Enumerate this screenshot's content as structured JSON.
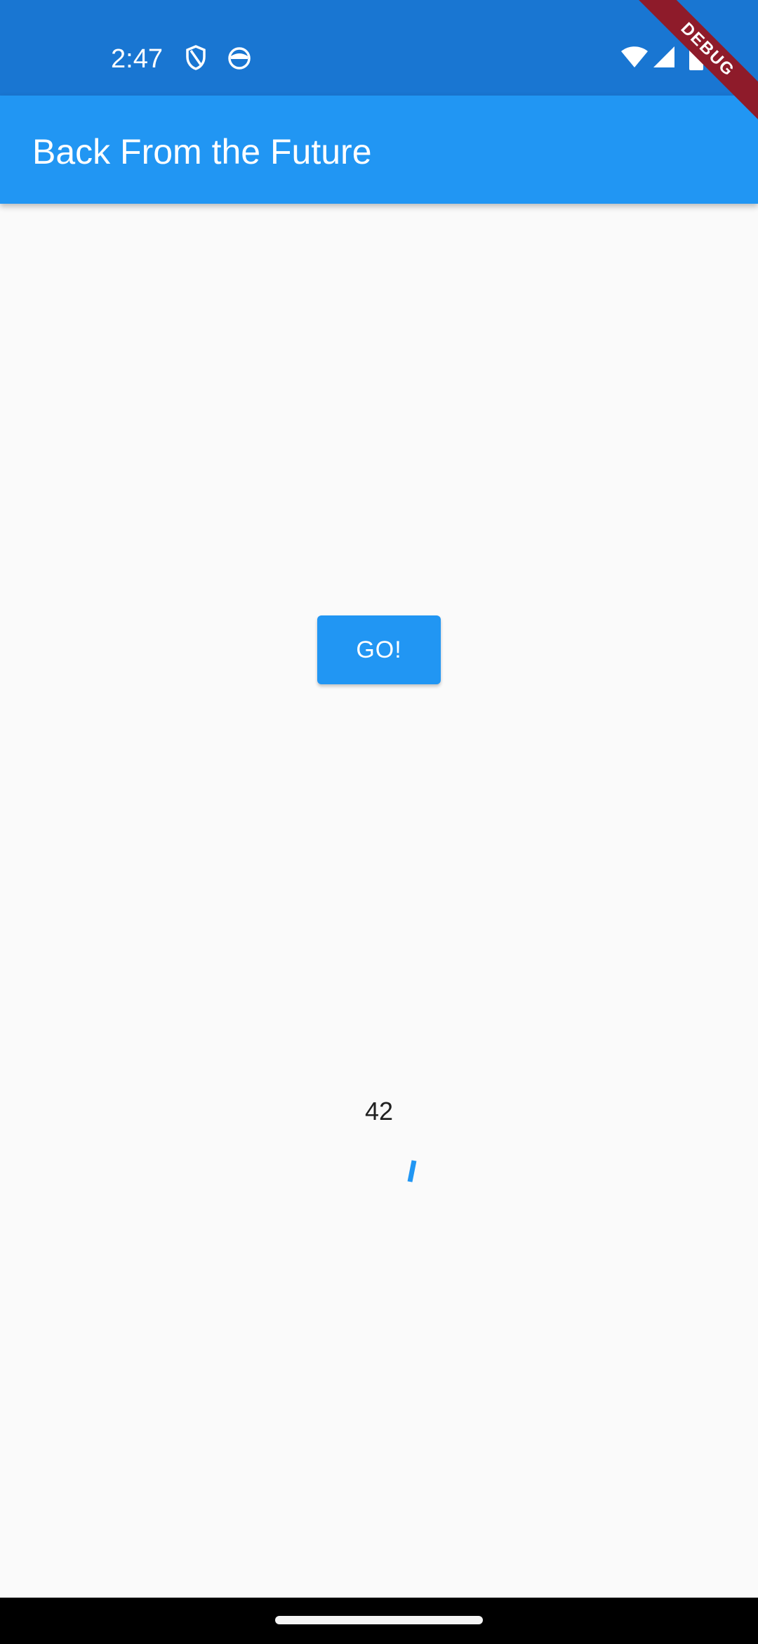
{
  "status_bar": {
    "time": "2:47",
    "icons": [
      "shield-icon",
      "face-icon",
      "wifi-icon",
      "cell-signal-icon",
      "battery-icon"
    ],
    "color": "#1976d2"
  },
  "debug_banner": {
    "label": "DEBUG",
    "color": "#8e1b2a"
  },
  "app_bar": {
    "title": "Back From the Future",
    "color": "#2196f3"
  },
  "main": {
    "go_button_label": "GO!",
    "result": "42",
    "accent": "#2196f3"
  },
  "nav_bar": {
    "color": "#000000"
  }
}
